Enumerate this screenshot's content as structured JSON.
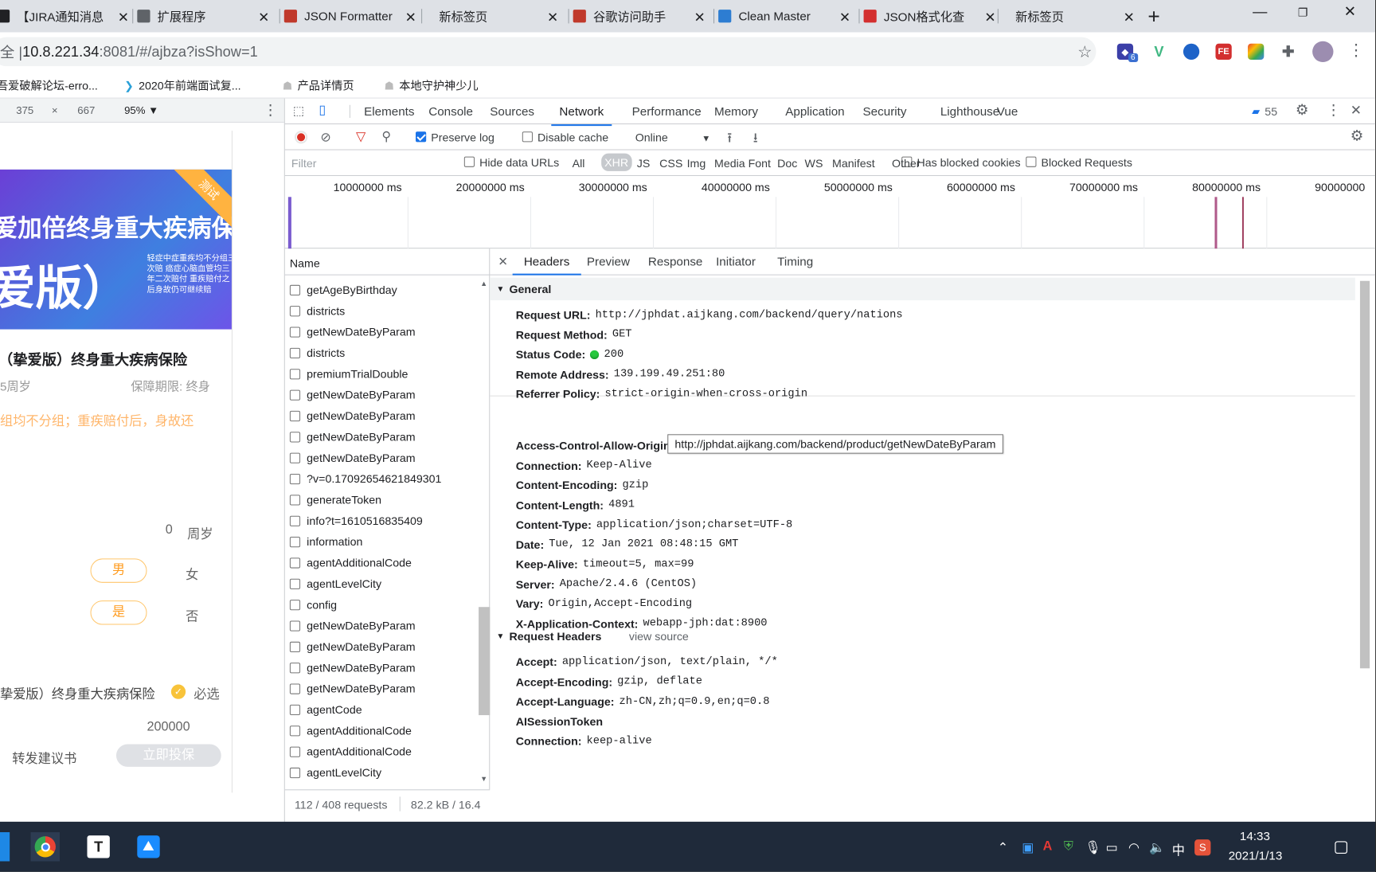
{
  "tabs": [
    {
      "label": "【JIRA通知消息",
      "favicon": "jira-icon",
      "color": "#202124"
    },
    {
      "label": "扩展程序",
      "favicon": "puzzle-icon",
      "color": "#5f6368"
    },
    {
      "label": "JSON Formatter",
      "favicon": "json-formatter-icon",
      "color": "#c0392b"
    },
    {
      "label": "新标签页",
      "favicon": "",
      "color": ""
    },
    {
      "label": "谷歌访问助手",
      "favicon": "helper-icon",
      "color": "#c0392b"
    },
    {
      "label": "Clean Master",
      "favicon": "clean-master-icon",
      "color": "#2d7dd2"
    },
    {
      "label": "JSON格式化查",
      "favicon": "fe-icon",
      "color": "#d32f2f"
    },
    {
      "label": "新标签页",
      "favicon": "",
      "color": ""
    }
  ],
  "omnibox": {
    "prefix": "全 | ",
    "host": "10.8.221.34",
    "rest": ":8081/#/ajbza?isShow=1"
  },
  "extensions": {
    "badge": "6"
  },
  "bookmarks": [
    "吾爱破解论坛-erro...",
    "2020年前端面试复...",
    "产品详情页",
    "本地守护神少儿"
  ],
  "device_bar": {
    "width": "375",
    "times": "×",
    "height": "667",
    "zoom": "95% ▼"
  },
  "mobile": {
    "banner_line1": "爱加倍终身重大疾病保险",
    "banner_line2": "爱版）",
    "banner_small": "轻症中症重疾均不分组三次赔 癌症心脑血管均三年二次赔付 重疾赔付之后身故仍可继续赔",
    "banner_tag": "测试",
    "product_title": "（挚爱版）终身重大疾病保险",
    "age_left": "5周岁",
    "period": "保障期限: 终身",
    "feature": "组均不分组；重疾赔付后，身故还",
    "age_value": "0",
    "age_unit": "周岁",
    "male": "男",
    "female": "女",
    "yes": "是",
    "no": "否",
    "plan_name": "挚爱版）终身重大疾病保险",
    "required": "必选",
    "amount": "200000",
    "forward": "转发建议书",
    "insure": "立即投保"
  },
  "devtools": {
    "tabs": [
      "Elements",
      "Console",
      "Sources",
      "Network",
      "Performance",
      "Memory",
      "Application",
      "Security",
      "Lighthouse",
      "Vue"
    ],
    "active_tab": "Network",
    "issues_count": "55",
    "preserve_log": "Preserve log",
    "disable_cache": "Disable cache",
    "throttle": "Online",
    "filter_placeholder": "Filter",
    "hide_data_urls": "Hide data URLs",
    "types": [
      "All",
      "XHR",
      "JS",
      "CSS",
      "Img",
      "Media",
      "Font",
      "Doc",
      "WS",
      "Manifest",
      "Other"
    ],
    "active_type": "XHR",
    "has_blocked": "Has blocked cookies",
    "blocked_requests": "Blocked Requests",
    "timeline_ticks": [
      "10000000 ms",
      "20000000 ms",
      "30000000 ms",
      "40000000 ms",
      "50000000 ms",
      "60000000 ms",
      "70000000 ms",
      "80000000 ms",
      "90000000"
    ],
    "name_header": "Name",
    "requests": [
      "getAgeByBirthday",
      "districts",
      "getNewDateByParam",
      "districts",
      "premiumTrialDouble",
      "getNewDateByParam",
      "getNewDateByParam",
      "getNewDateByParam",
      "getNewDateByParam",
      "?v=0.17092654621849301",
      "generateToken",
      "info?t=1610516835409",
      "information",
      "agentAdditionalCode",
      "agentLevelCity",
      "config",
      "getNewDateByParam",
      "getNewDateByParam",
      "getNewDateByParam",
      "getNewDateByParam",
      "agentCode",
      "agentAdditionalCode",
      "agentAdditionalCode",
      "agentLevelCity"
    ],
    "status_requests": "112 / 408 requests",
    "status_size": "82.2 kB / 16.4",
    "tooltip": "http://jphdat.aijkang.com/backend/product/getNewDateByParam",
    "detail_tabs": [
      "Headers",
      "Preview",
      "Response",
      "Initiator",
      "Timing"
    ],
    "general_title": "General",
    "general": [
      {
        "k": "Request URL:",
        "v": "http://jphdat.aijkang.com/backend/query/nations"
      },
      {
        "k": "Request Method:",
        "v": "GET"
      },
      {
        "k": "Status Code:",
        "v": "200"
      },
      {
        "k": "Remote Address:",
        "v": "139.199.49.251:80"
      },
      {
        "k": "Referrer Policy:",
        "v": "strict-origin-when-cross-origin"
      }
    ],
    "response_headers": [
      {
        "k": "Access-Control-Allow-Origin:",
        "v": "*"
      },
      {
        "k": "Connection:",
        "v": "Keep-Alive"
      },
      {
        "k": "Content-Encoding:",
        "v": "gzip"
      },
      {
        "k": "Content-Length:",
        "v": "4891"
      },
      {
        "k": "Content-Type:",
        "v": "application/json;charset=UTF-8"
      },
      {
        "k": "Date:",
        "v": "Tue, 12 Jan 2021 08:48:15 GMT"
      },
      {
        "k": "Keep-Alive:",
        "v": "timeout=5, max=99"
      },
      {
        "k": "Server:",
        "v": "Apache/2.4.6 (CentOS)"
      },
      {
        "k": "Vary:",
        "v": "Origin,Accept-Encoding"
      },
      {
        "k": "X-Application-Context:",
        "v": "webapp-jph:dat:8900"
      }
    ],
    "request_headers_title": "Request Headers",
    "view_source": "view source",
    "request_headers": [
      {
        "k": "Accept:",
        "v": "application/json, text/plain, */*"
      },
      {
        "k": "Accept-Encoding:",
        "v": "gzip, deflate"
      },
      {
        "k": "Accept-Language:",
        "v": "zh-CN,zh;q=0.9,en;q=0.8"
      },
      {
        "k": "AISessionToken",
        "v": ""
      },
      {
        "k": "Connection:",
        "v": "keep-alive"
      }
    ]
  },
  "taskbar": {
    "time": "14:33",
    "date": "2021/1/13",
    "ime": "中"
  }
}
